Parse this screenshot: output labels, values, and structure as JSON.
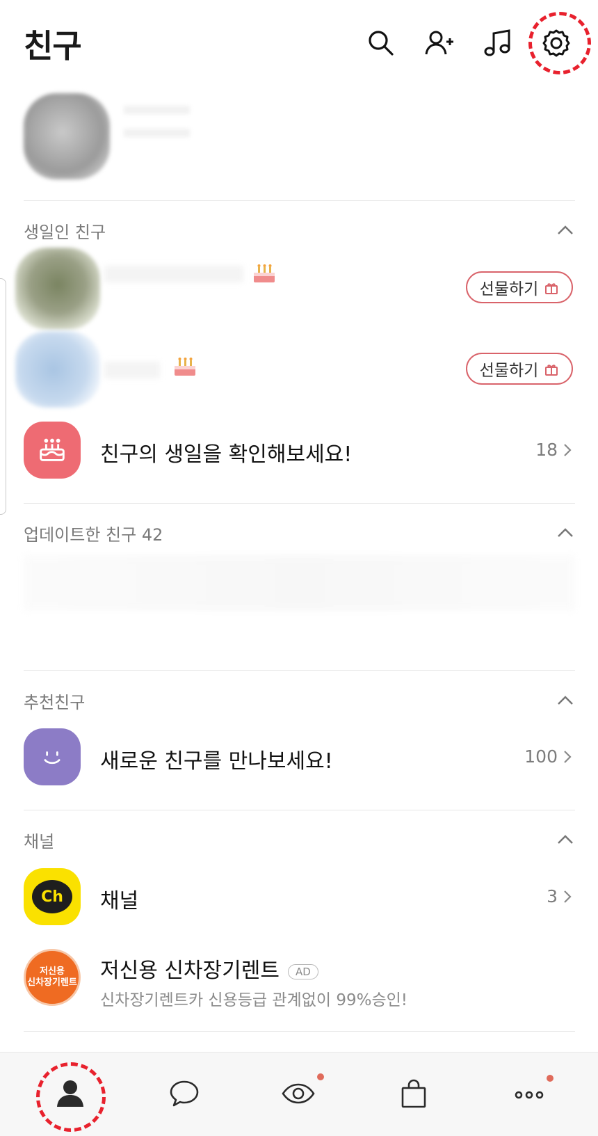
{
  "header": {
    "title": "친구",
    "icons": [
      "search-icon",
      "add-friend-icon",
      "music-icon",
      "settings-icon"
    ]
  },
  "birthday_section": {
    "label": "생일인 친구",
    "friends": [
      {
        "gift_label": "선물하기"
      },
      {
        "gift_label": "선물하기"
      }
    ],
    "check_row": {
      "title": "친구의 생일을 확인해보세요!",
      "count": "18"
    }
  },
  "updated_section": {
    "label": "업데이트한 친구 42"
  },
  "recommend_section": {
    "label": "추천친구",
    "row": {
      "title": "새로운 친구를 만나보세요!",
      "count": "100"
    }
  },
  "channel_section": {
    "label": "채널",
    "channel_row": {
      "title": "채널",
      "count": "3",
      "icon_text": "Ch"
    },
    "ad_row": {
      "title": "저신용 신차장기렌트",
      "badge": "AD",
      "subtitle": "신차장기렌트카 신용등급 관계없이 99%승인!",
      "logo_text_top": "저신용",
      "logo_text_bottom": "신차장기렌트"
    }
  },
  "bottom_nav": {
    "items": [
      "friends-tab",
      "chats-tab",
      "view-tab",
      "shopping-tab",
      "more-tab"
    ]
  },
  "colors": {
    "accent_red": "#e8212d",
    "birthday_icon_bg": "#ee6b73",
    "recommend_icon_bg": "#8c7cc6",
    "channel_icon_bg": "#fae100",
    "ad_logo_bg": "#ef6b22",
    "notification_dot": "#e06b5b"
  }
}
